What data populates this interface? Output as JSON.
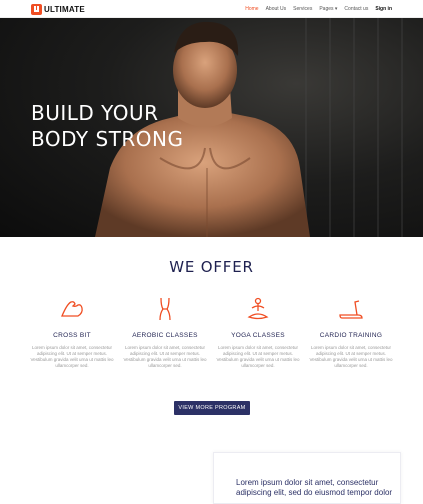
{
  "brand": {
    "name": "ULTIMATE",
    "accent": "#f04e23"
  },
  "nav": {
    "items": [
      "Home",
      "About Us",
      "Services",
      "Pages ▾",
      "Contact us"
    ],
    "signin": "Sign in"
  },
  "hero": {
    "title_line1": "BUILD YOUR",
    "title_line2": "BODY STRONG"
  },
  "offer": {
    "title": "WE OFFER",
    "features": [
      {
        "icon": "muscle-arm-icon",
        "name": "CROSS BIT",
        "desc": "Lorem ipsum dolor sit amet, consectetur adipiscing elit. Ut at semper metus. Vestibulum gravida velit urna ut mattis leo ullamcorper sed."
      },
      {
        "icon": "body-figure-icon",
        "name": "AEROBIC CLASSES",
        "desc": "Lorem ipsum dolor sit amet, consectetur adipiscing elit. Ut at semper metus. Vestibulum gravida velit urna ut mattis leo ullamcorper sed."
      },
      {
        "icon": "yoga-pose-icon",
        "name": "YOGA CLASSES",
        "desc": "Lorem ipsum dolor sit amet, consectetur adipiscing elit. Ut at semper metus. Vestibulum gravida velit urna ut mattis leo ullamcorper sed."
      },
      {
        "icon": "treadmill-icon",
        "name": "CARDIO TRAINING",
        "desc": "Lorem ipsum dolor sit amet, consectetur adipiscing elit. Ut at semper metus. Vestibulum gravida velit urna ut mattis leo ullamcorper sed."
      }
    ],
    "button": "VIEW MORE PROGRAM"
  },
  "card": {
    "text": "Lorem ipsum dolor sit amet, consectetur adipiscing elit, sed do eiusmod tempor dolor"
  }
}
